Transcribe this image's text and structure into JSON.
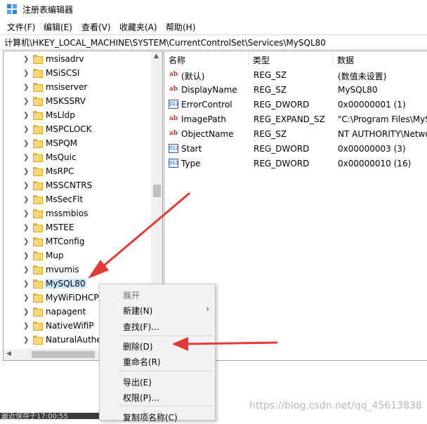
{
  "window": {
    "title": "注册表编辑器",
    "icon": "regedit-icon"
  },
  "menu": [
    "文件(F)",
    "编辑(E)",
    "查看(V)",
    "收藏夹(A)",
    "帮助(H)"
  ],
  "address": "计算机\\HKEY_LOCAL_MACHINE\\SYSTEM\\CurrentControlSet\\Services\\MySQL80",
  "tree": {
    "items": [
      "msisadrv",
      "MSiSCSI",
      "msiserver",
      "MSKSSRV",
      "MsLldp",
      "MSPCLOCK",
      "MSPQM",
      "MsQuic",
      "MsRPC",
      "MSSCNTRS",
      "MsSecFlt",
      "mssmbios",
      "MSTEE",
      "MTConfig",
      "Mup",
      "mvumis",
      "MySQL80",
      "MyWiFiDHCP",
      "napagent",
      "NativeWifiP",
      "NaturalAuthe"
    ],
    "selected": "MySQL80"
  },
  "values": {
    "headers": {
      "name": "名称",
      "type": "类型",
      "data": "数据"
    },
    "rows": [
      {
        "icon": "ab-icon",
        "name": "(默认)",
        "type": "REG_SZ",
        "data": "(数值未设置)"
      },
      {
        "icon": "ab-icon",
        "name": "DisplayName",
        "type": "REG_SZ",
        "data": "MySQL80"
      },
      {
        "icon": "dword-icon",
        "name": "ErrorControl",
        "type": "REG_DWORD",
        "data": "0x00000001 (1)"
      },
      {
        "icon": "ab-icon",
        "name": "ImagePath",
        "type": "REG_EXPAND_SZ",
        "data": "\"C:\\Program Files\\MyS"
      },
      {
        "icon": "ab-icon",
        "name": "ObjectName",
        "type": "REG_SZ",
        "data": "NT AUTHORITY\\Netwo"
      },
      {
        "icon": "dword-icon",
        "name": "Start",
        "type": "REG_DWORD",
        "data": "0x00000003 (3)"
      },
      {
        "icon": "dword-icon",
        "name": "Type",
        "type": "REG_DWORD",
        "data": "0x00000010 (16)"
      }
    ]
  },
  "context_menu": {
    "expand": "展开",
    "new": "新建(N)",
    "find": "查找(F)...",
    "delete": "删除(D)",
    "rename": "重命名(R)",
    "export": "导出(E)",
    "permissions": "权限(P)...",
    "copy_key_name": "复制项名称(C)"
  },
  "status": "最近保存于17:00:55",
  "watermark": "https://blog.csdn.net/qq_45613838",
  "colors": {
    "annotation": "#e53935",
    "selection": "#cce8ff",
    "folder": "#f8d775"
  }
}
